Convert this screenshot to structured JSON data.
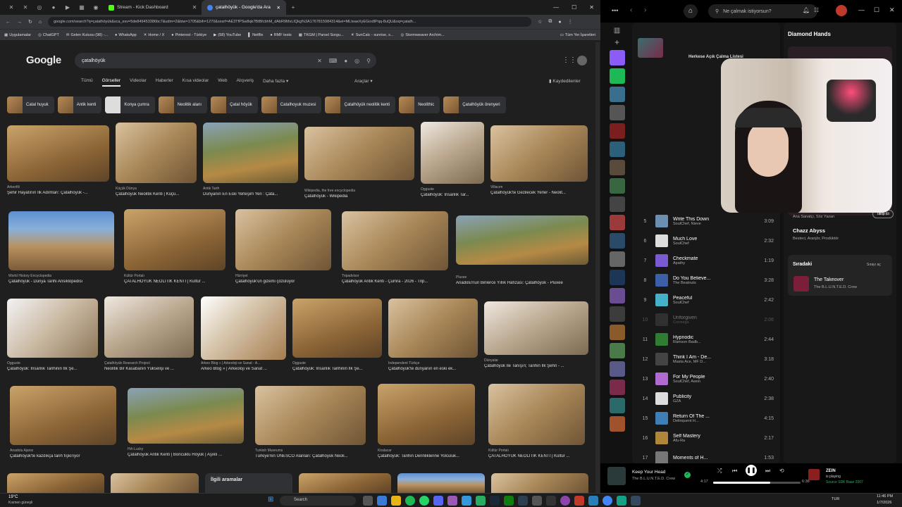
{
  "browser": {
    "tabs": [
      {
        "label": "Stream - Kick Dashboard",
        "active": false
      },
      {
        "label": "çatalhöyük - Google'da Ara",
        "active": true
      }
    ],
    "url": "google.com/search?q=çatalhöyük&sca_esv=5de849453386bc7&udm=2&biw=1705&bih=1270&sxsrf=AE3TfPSw8qk7BtBfcbhM_dAbR9MxLIQkg%3A1767815984314&ei=MLteaeXyEGox8Pqq-8uQU&oq=çatalh...",
    "bookmarks": [
      "Uygulamalar",
      "ChatGPT",
      "Gelen Kutusu (98) -...",
      "WhatsApp",
      "Home / X",
      "Pinterest - Türkiye",
      "(58) YouTube",
      "Netflix",
      "RMF tests",
      "TKGM | Parsel Sorgu...",
      "SunCalc - sunrise, s...",
      "Stormweaver Archim..."
    ],
    "bookmarks_right": "Tüm Yer İşaretleri"
  },
  "google": {
    "logo": "Google",
    "query": "çatalhöyük",
    "nav_tabs": [
      "Tümü",
      "Görseller",
      "Videolar",
      "Haberler",
      "Kısa videolar",
      "Web",
      "Alışveriş",
      "Daha fazla"
    ],
    "active_tab": "Görseller",
    "tools": "Araçlar",
    "saved": "Kaydedilenler",
    "chips": [
      "Catal huyuk",
      "Antik kenti",
      "Konya çumra",
      "Neolitik alanı",
      "Çatal höyük",
      "Catalhoyuk muzesi",
      "Çatalhöyük neolitik kenti",
      "Neolithic",
      "Çatalhöyük örenyeri"
    ],
    "related": "İlgili aramalar",
    "results": [
      {
        "source": "Arkeofili",
        "title": "Şehir Hayatının İlk Adımları: Çatalhöyük -..."
      },
      {
        "source": "Küçük Dünya",
        "title": "Çatalhöyük Neolitik Kenti | Küçü..."
      },
      {
        "source": "Antik Tarih",
        "title": "Dünyanın En Eski Yerleşim Yeri : Çata..."
      },
      {
        "source": "Wikipedia, the free encyclopedia",
        "title": "Çatalhöyük - Wikipedia"
      },
      {
        "source": "Ogguste",
        "title": "Çatalhöyük: İnsanlık Tar..."
      },
      {
        "source": "Villacım",
        "title": "Çatalhöyük'te Gezilecek Yerler - Neolit..."
      },
      {
        "source": "World History Encyclopedia",
        "title": "Çatalhöyük - Dünya Tarihi Ansiklopedisi"
      },
      {
        "source": "Kültür Portalı",
        "title": "ÇATALHÖYÜK NEOLİTİK KENTİ | Kültür ..."
      },
      {
        "source": "Hürriyet",
        "title": "Çatalhöyük'ün gizemi çözülüyor"
      },
      {
        "source": "Tripadvisor",
        "title": "Çatalhöyük Antik Kenti - Çumra - 2026 - Trip..."
      },
      {
        "source": "Pluxee",
        "title": "Anadolu'nun Binlerce Yıllık Hafızası: Çatalhöyük - Pluxee"
      },
      {
        "source": "Ogguste",
        "title": "Çatalhöyük: İnsanlık Tarihinin İlk Şe..."
      },
      {
        "source": "Çatalhöyük Research Project",
        "title": "Neolitik Bir Kasabanın Yükselişi ve ..."
      },
      {
        "source": "Arkeo Blog » | Arkeoloji ve Sanat - A...",
        "title": "Arkeo Blog » | Arkeoloji ve Sanat ..."
      },
      {
        "source": "Ogguste",
        "title": "Çatalhöyük: İnsanlık Tarihinin İlk Şe..."
      },
      {
        "source": "Independent Türkçe",
        "title": "Çatalhöyük'te dünyanın en eski ek..."
      },
      {
        "source": "Dünyalar",
        "title": "Çatalhöyük İle Tanışın; Tarihin İlk Şehri - ..."
      },
      {
        "source": "Anadolu Ajansı",
        "title": "Çatalhöyük'te kazdıkça tarih fışkırıyor"
      },
      {
        "source": "Hıh Lucky",
        "title": "Çatalhöyük Antik Kenti | Boncuklu Höyük | Aşıklı ..."
      },
      {
        "source": "Turkish Museums",
        "title": "Türkiye'nin UNESCO Alanları: Çatalhöyük Neoli..."
      },
      {
        "source": "Kiralacar",
        "title": "Çatalhöyük: Tarihin Derinliklerine Yolculuk..."
      },
      {
        "source": "Kültür Portalı",
        "title": "ÇATALHÖYÜK NEOLİTİK KENTİ | Kültür ..."
      }
    ]
  },
  "spotify": {
    "search_placeholder": "Ne çalmak istiyorsun?",
    "playlist_label": "Herkese Açık Çalma Listesi",
    "artist_name": "Diamond Hands",
    "artist_roles": "Ana Sanatçı, Söz Yazarı",
    "follow_label": "Takip Et",
    "credit_name": "Chazz Abyss",
    "credit_roles": "Besteci, Aranjör, Prodüktör",
    "queue_label": "Sıradaki",
    "queue_open": "Sırayı aç",
    "queue_item": {
      "title": "The Takeover",
      "artist": "The B.L.U.N.T.E.D. Crew"
    },
    "tracks": [
      {
        "n": "5",
        "title": "Write This Down",
        "artist": "SoulChef, Nieve",
        "dur": "3:09",
        "color": "#6b8fb3"
      },
      {
        "n": "6",
        "title": "Much Love",
        "artist": "SoulChef",
        "dur": "2:32",
        "color": "#ddd"
      },
      {
        "n": "7",
        "title": "Checkmate",
        "artist": "Apathy",
        "dur": "1:19",
        "color": "#7a5ad1"
      },
      {
        "n": "8",
        "title": "Do You Believe...",
        "artist": "The Beatnuts",
        "dur": "3:28",
        "color": "#3b60a8"
      },
      {
        "n": "9",
        "title": "Peaceful",
        "artist": "SoulChef",
        "dur": "2:42",
        "color": "#45b0c9"
      },
      {
        "n": "10",
        "title": "Unforgiven",
        "artist": "Cormega",
        "dur": "2:06",
        "color": "#555"
      },
      {
        "n": "11",
        "title": "Hypnodic",
        "artist": "Ramson Badb...",
        "dur": "2:44",
        "color": "#2e7d32"
      },
      {
        "n": "12",
        "title": "Think I Am - De...",
        "artist": "Masta Ace, MF D...",
        "dur": "3:18",
        "color": "#444"
      },
      {
        "n": "13",
        "title": "For My People",
        "artist": "SoulChef, Awon",
        "dur": "2:40",
        "color": "#b06ad1"
      },
      {
        "n": "14",
        "title": "Publicity",
        "artist": "GZA",
        "dur": "2:38",
        "color": "#ddd"
      },
      {
        "n": "15",
        "title": "Return Of The ...",
        "artist": "Delinquent H...",
        "dur": "4:15",
        "color": "#3f7fb8"
      },
      {
        "n": "16",
        "title": "Self Mastery",
        "artist": "Afu-Ra",
        "dur": "2:17",
        "color": "#b0873a"
      },
      {
        "n": "17",
        "title": "Moments of H...",
        "artist": "",
        "dur": "1:53",
        "color": "#777"
      }
    ],
    "now_playing": {
      "title": "Keep Your Head",
      "artist": "The B.L.U.N.T.E.D. Crew",
      "elapsed": "4:17",
      "total": "6:38"
    },
    "progress": 0.65,
    "friend": {
      "name": "ZEIN",
      "status": "is playing",
      "sub": "Source SDK Base 2007"
    }
  },
  "taskbar": {
    "weather_temp": "19°C",
    "weather_desc": "Kısmen güneşli",
    "search": "Search",
    "lang": "TUR",
    "time": "11:46 PM",
    "date": "1/7/2026"
  }
}
